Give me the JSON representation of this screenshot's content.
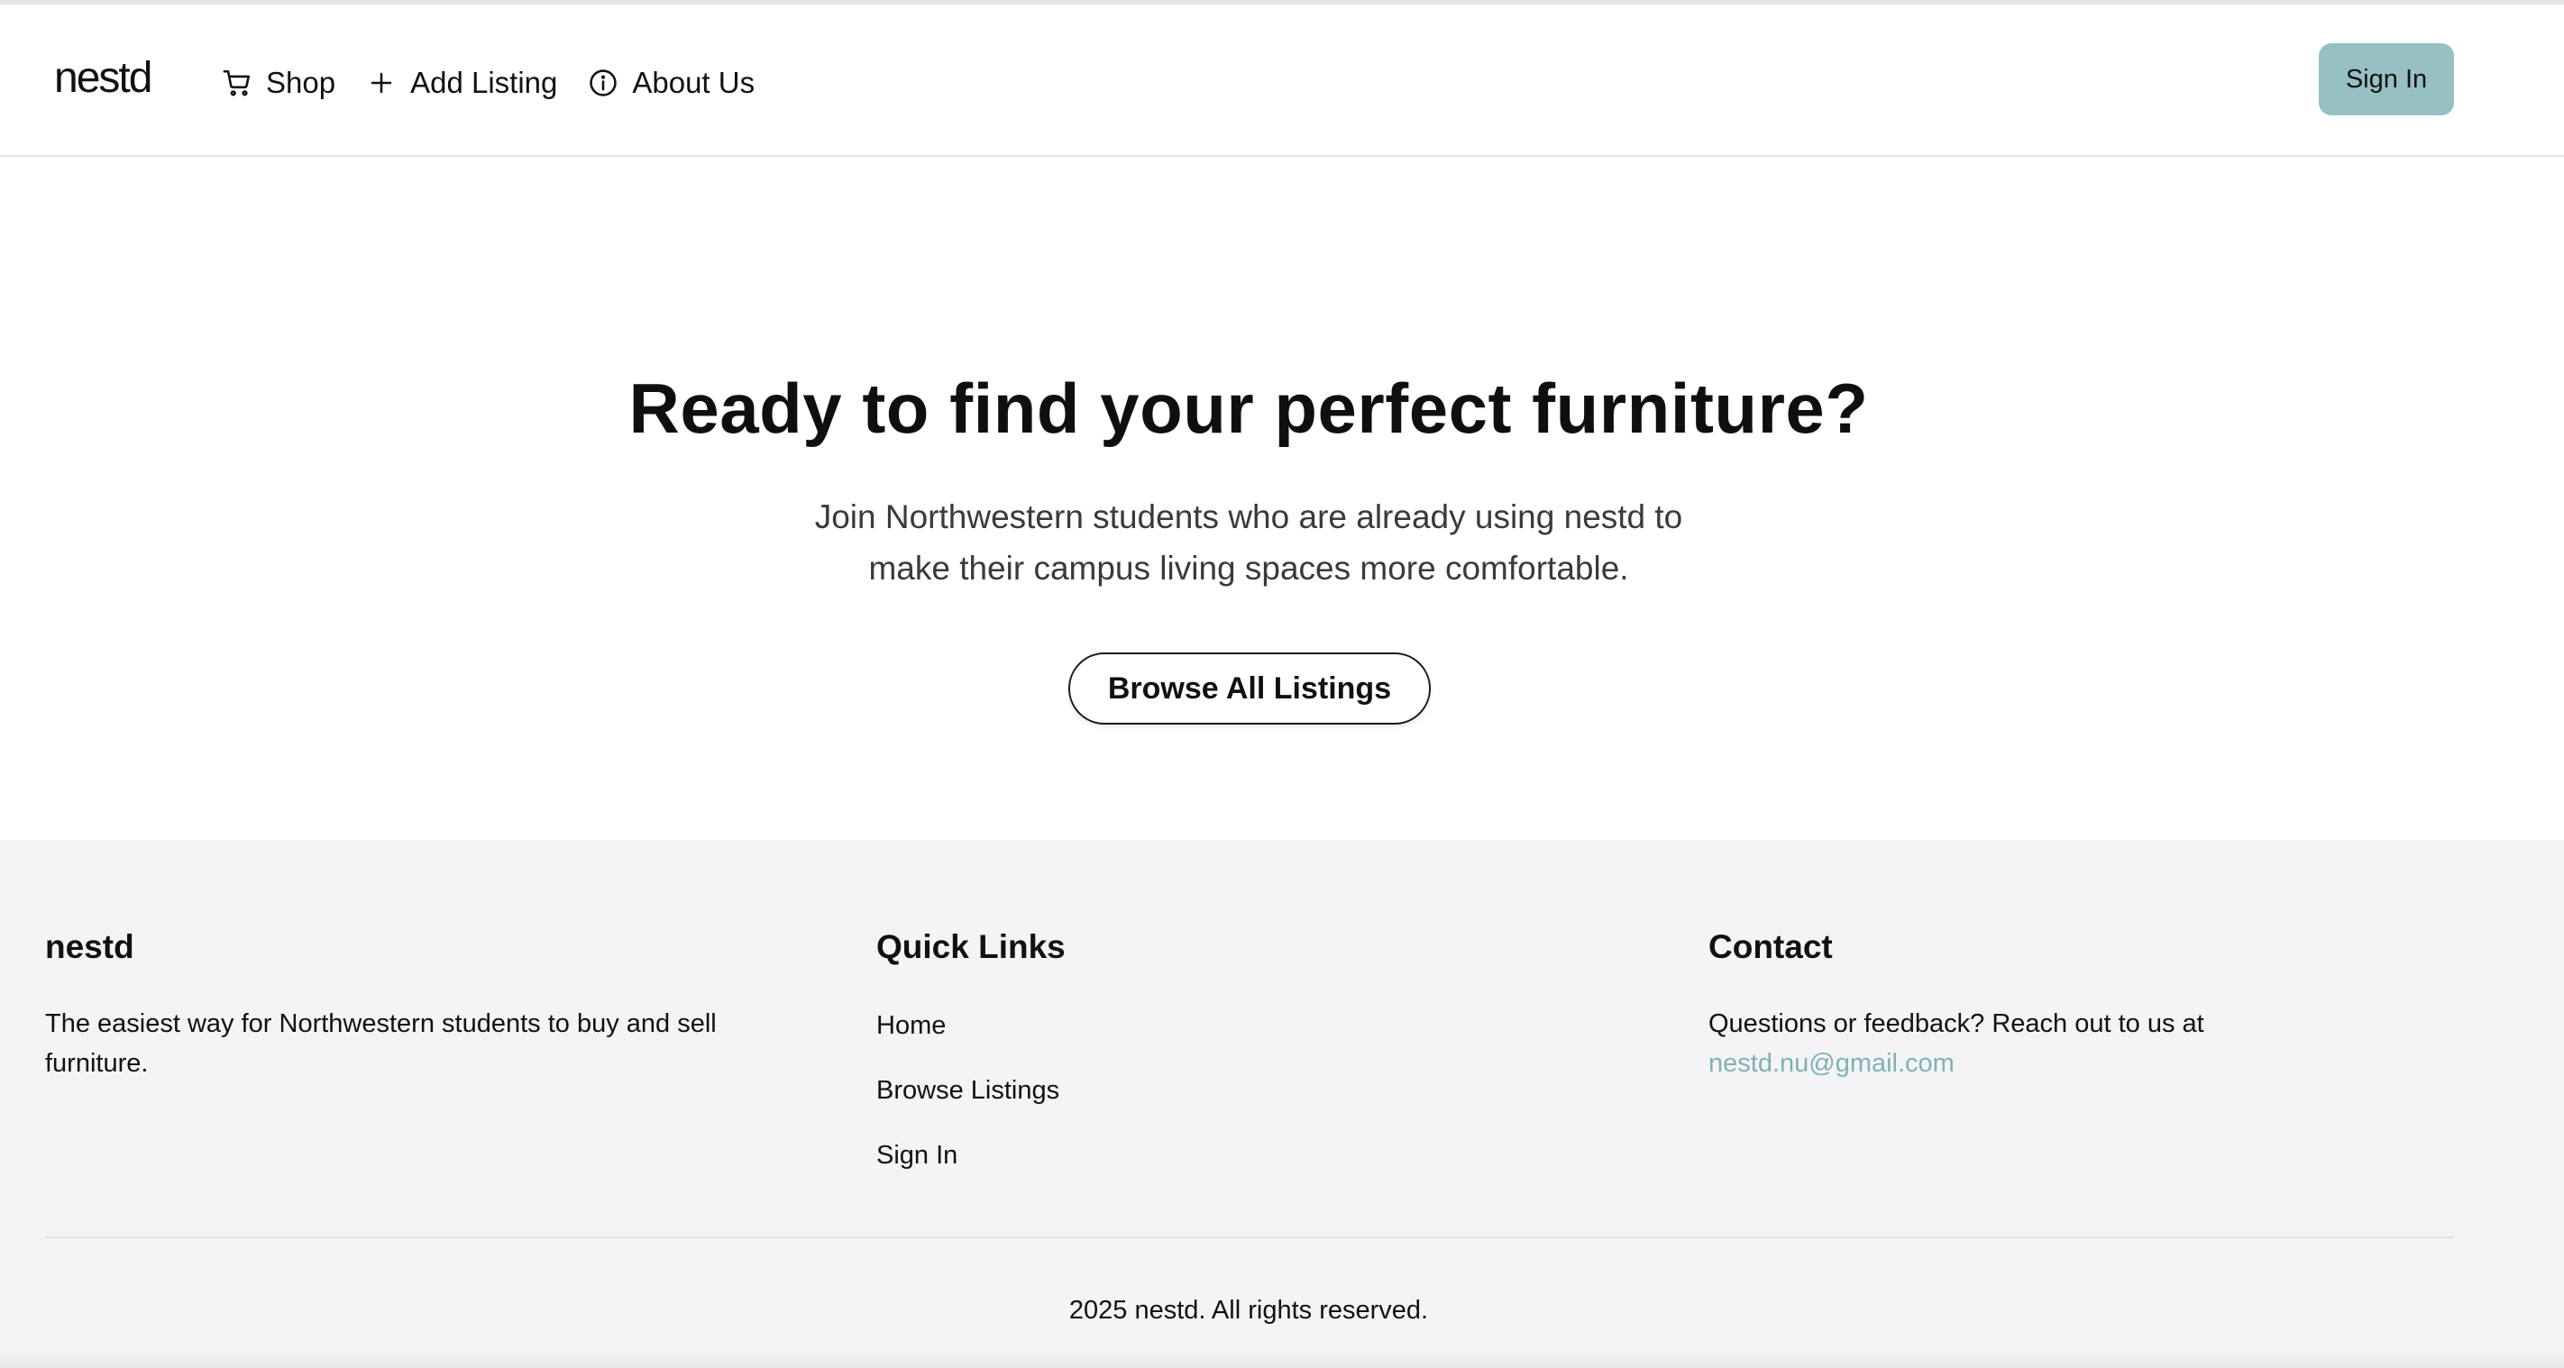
{
  "header": {
    "logo": "nestd",
    "nav": [
      {
        "label": "Shop",
        "icon": "cart-icon"
      },
      {
        "label": "Add Listing",
        "icon": "plus-icon"
      },
      {
        "label": "About Us",
        "icon": "info-icon"
      }
    ],
    "sign_in_label": "Sign In"
  },
  "hero": {
    "title": "Ready to find your perfect furniture?",
    "subtitle": "Join Northwestern students who are already using nestd to make their campus living spaces more comfortable.",
    "button_label": "Browse All Listings"
  },
  "footer": {
    "brand": {
      "title": "nestd",
      "description": "The easiest way for Northwestern students to buy and sell furniture."
    },
    "quick_links": {
      "title": "Quick Links",
      "items": [
        "Home",
        "Browse Listings",
        "Sign In"
      ]
    },
    "contact": {
      "title": "Contact",
      "text": "Questions or feedback? Reach out to us at",
      "email": "nestd.nu@gmail.com"
    },
    "copyright": "2025 nestd. All rights reserved."
  },
  "colors": {
    "accent": "#96c0c1",
    "link": "#7fb2b4",
    "footer_bg": "#f4f4f6"
  }
}
